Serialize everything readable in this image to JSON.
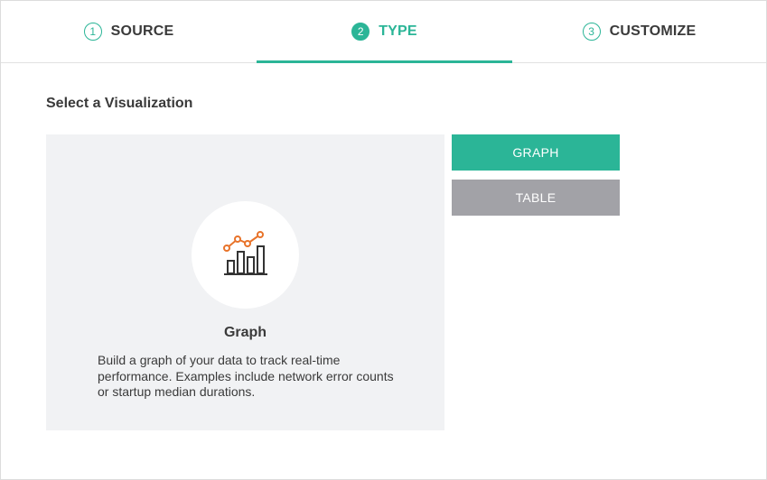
{
  "stepper": {
    "steps": [
      {
        "number": "1",
        "label": "SOURCE",
        "active": false
      },
      {
        "number": "2",
        "label": "TYPE",
        "active": true
      },
      {
        "number": "3",
        "label": "CUSTOMIZE",
        "active": false
      }
    ]
  },
  "main": {
    "title": "Select a Visualization",
    "preview": {
      "icon": "bar-line-chart-icon",
      "title": "Graph",
      "description": "Build a graph of your data to track real-time performance. Examples include network error counts or startup median durations."
    },
    "buttons": {
      "graph_label": "GRAPH",
      "table_label": "TABLE"
    }
  },
  "colors": {
    "accent": "#2bb597",
    "inactive_button": "#a2a2a7",
    "icon_line": "#e8732a",
    "panel_bg": "#f1f2f4"
  }
}
